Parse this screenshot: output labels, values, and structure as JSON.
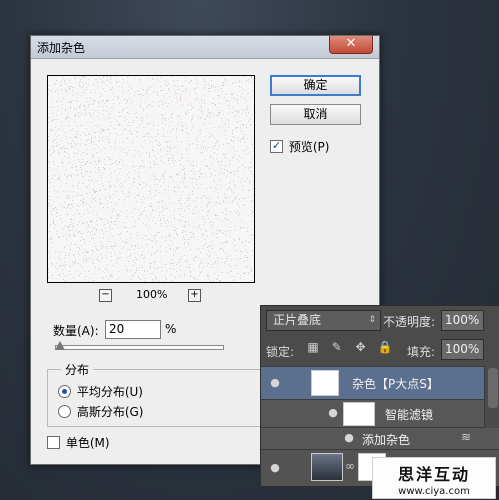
{
  "dialog": {
    "title": "添加杂色",
    "close_glyph": "✕",
    "zoom_minus": "−",
    "zoom_plus": "+",
    "zoom_level": "100%",
    "ok_label": "确定",
    "cancel_label": "取消",
    "preview_label": "预览(P)",
    "preview_checked": true,
    "check_glyph": "✓",
    "amount_label": "数量(A):",
    "amount_value": "20",
    "amount_unit": "%",
    "distribution_label": "分布",
    "uniform_label": "平均分布(U)",
    "gaussian_label": "高斯分布(G)",
    "selected_distribution": "uniform",
    "monochromatic_label": "单色(M)",
    "monochromatic_checked": false
  },
  "layers": {
    "blend_mode": "正片叠底",
    "blend_arrow": "⇕",
    "opacity_label": "不透明度:",
    "opacity_value": "100%",
    "lock_label": "锁定:",
    "fill_label": "填充:",
    "fill_value": "100%",
    "eye_glyph": "●",
    "lock_icons": [
      "▦",
      "✎",
      "✥",
      "🔒"
    ],
    "rows": {
      "noise_layer_name": "杂色【P大点S】",
      "smart_filters_label": "智能滤镜",
      "add_noise_filter_label": "添加杂色",
      "link_glyph": "∞"
    }
  },
  "watermark": {
    "title": "思洋互动",
    "url": "www.ciya.com"
  }
}
